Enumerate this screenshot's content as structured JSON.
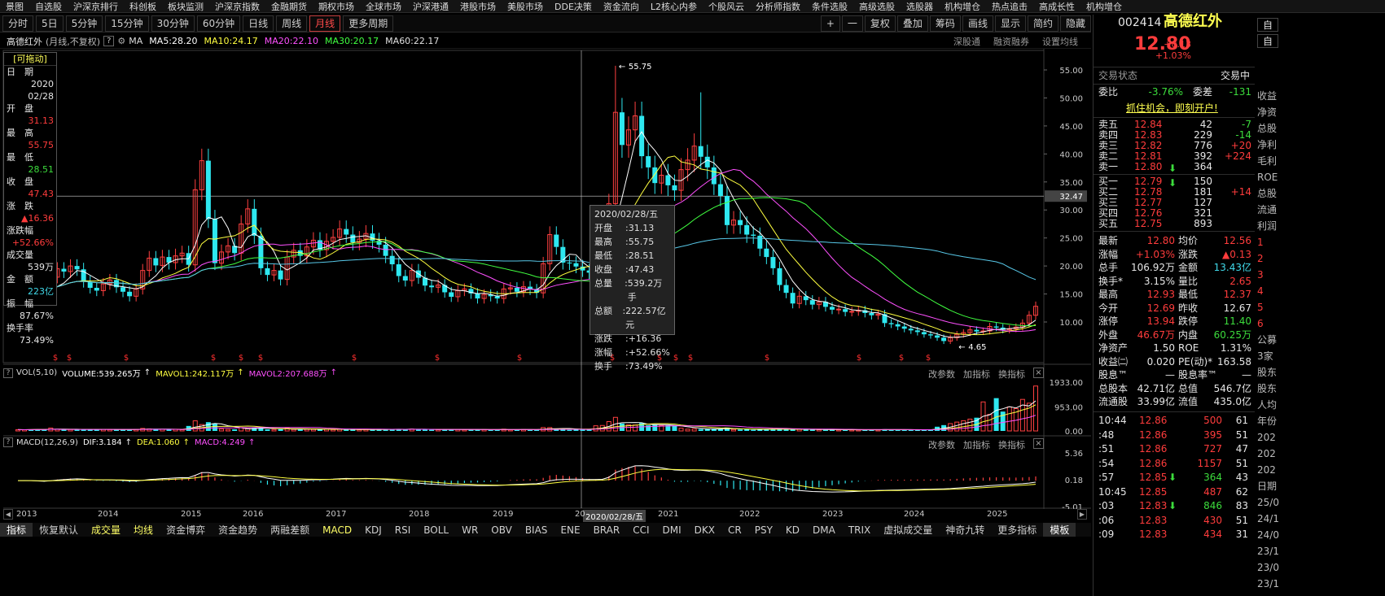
{
  "menu": [
    "景图",
    "自选股",
    "沪深京排行",
    "科创板",
    "板块监测",
    "沪深京指数",
    "金融期货",
    "期权市场",
    "全球市场",
    "沪深港通",
    "港股市场",
    "美股市场",
    "DDE决策",
    "资金流向",
    "L2核心内参",
    "个股风云",
    "分析师指数",
    "条件选股",
    "高级选股",
    "选股器",
    "机构增仓",
    "热点追击",
    "高成长性",
    "机构增仓"
  ],
  "timeframes": [
    {
      "label": "分时"
    },
    {
      "label": "5日"
    },
    {
      "label": "5分钟"
    },
    {
      "label": "15分钟"
    },
    {
      "label": "30分钟"
    },
    {
      "label": "60分钟"
    },
    {
      "label": "日线"
    },
    {
      "label": "周线"
    },
    {
      "label": "月线",
      "active": true
    },
    {
      "label": "更多周期"
    }
  ],
  "tools": [
    "+",
    "一",
    "复权",
    "叠加",
    "筹码",
    "画线",
    "显示",
    "简约",
    "隐藏"
  ],
  "header": {
    "name": "高德红外",
    "mode": "(月线,不复权)",
    "help": "?",
    "ma_label": "MA",
    "ma5": "MA5:28.20",
    "ma10": "MA10:24.17",
    "ma20": "MA20:22.10",
    "ma30": "MA30:20.17",
    "ma60": "MA60:22.17",
    "link1": "深股通",
    "link2": "融资融券",
    "link3": "设置均线"
  },
  "info_panel": {
    "title": "[可拖动]",
    "rows": [
      {
        "label": "日　期",
        "value": "2020"
      },
      {
        "label": "",
        "value": "02/28"
      },
      {
        "label": "开　盘",
        "value": "31.13",
        "color": "red"
      },
      {
        "label": "最　高",
        "value": "55.75",
        "color": "red"
      },
      {
        "label": "最　低",
        "value": "28.51",
        "color": "green"
      },
      {
        "label": "收　盘",
        "value": "47.43",
        "color": "red"
      },
      {
        "label": "涨　跌",
        "value": "▲16.36",
        "color": "red"
      },
      {
        "label": "涨跌幅",
        "value": "+52.66%",
        "color": "red"
      },
      {
        "label": "成交量",
        "value": "539万",
        "color": "white"
      },
      {
        "label": "金　额",
        "value": "223亿",
        "color": "cyan"
      },
      {
        "label": "振　幅",
        "value": "87.67%",
        "color": "white"
      },
      {
        "label": "换手率",
        "value": "73.49%",
        "color": "white"
      }
    ]
  },
  "tooltip": {
    "date": "2020/02/28/五",
    "rows": [
      {
        "k": "开盘",
        "v": "31.13"
      },
      {
        "k": "最高",
        "v": "55.75"
      },
      {
        "k": "最低",
        "v": "28.51"
      },
      {
        "k": "收盘",
        "v": "47.43"
      },
      {
        "k": "总量",
        "v": "539.2万手"
      },
      {
        "k": "总额",
        "v": "222.57亿元"
      },
      {
        "k": "涨跌",
        "v": "+16.36"
      },
      {
        "k": "涨幅",
        "v": "+52.66%"
      },
      {
        "k": "换手",
        "v": "73.49%"
      }
    ]
  },
  "price_axis": [
    "55.00",
    "50.00",
    "45.00",
    "40.00",
    "35.00",
    "30.00",
    "25.00",
    "20.00",
    "15.00",
    "10.00"
  ],
  "cursor_price": "32.47",
  "high_marker": "55.75",
  "low_marker": "4.65",
  "volume": {
    "label": "VOL(5,10)",
    "volume": "VOLUME:539.265万",
    "mavol1": "MAVOL1:242.117万",
    "mavol2": "MAVOL2:207.688万",
    "axis": [
      "1933.00",
      "953.00",
      "0.00"
    ]
  },
  "macd": {
    "label": "MACD(12,26,9)",
    "dif": "DIF:3.184",
    "dea": "DEA:1.060",
    "macd": "MACD:4.249",
    "axis": [
      "5.36",
      "0.18",
      "-5.01"
    ]
  },
  "panel_links": [
    "改参数",
    "加指标",
    "换指标"
  ],
  "close_btn": "×",
  "years": [
    "2013",
    "2014",
    "2015",
    "2016",
    "2017",
    "2018",
    "2019",
    "20",
    "2021",
    "2022",
    "2023",
    "2024",
    "2025"
  ],
  "cursor_date": "2020/02/28/五",
  "scroll_left": "◀",
  "scroll_right": "▶",
  "indicators": [
    {
      "label": "指标",
      "sel": true
    },
    {
      "label": "恢复默认"
    },
    {
      "label": "成交量",
      "hl": true
    },
    {
      "label": "均线",
      "hl": true
    },
    {
      "label": "资金博弈"
    },
    {
      "label": "资金趋势"
    },
    {
      "label": "两融差额"
    },
    {
      "label": "MACD",
      "hl": true
    },
    {
      "label": "KDJ"
    },
    {
      "label": "RSI"
    },
    {
      "label": "BOLL"
    },
    {
      "label": "WR"
    },
    {
      "label": "OBV"
    },
    {
      "label": "BIAS"
    },
    {
      "label": "ENE"
    },
    {
      "label": "BRAR"
    },
    {
      "label": "CCI"
    },
    {
      "label": "DMI"
    },
    {
      "label": "DKX"
    },
    {
      "label": "CR"
    },
    {
      "label": "PSY"
    },
    {
      "label": "KD"
    },
    {
      "label": "DMA"
    },
    {
      "label": "TRIX"
    },
    {
      "label": "虚拟成交量"
    },
    {
      "label": "神奇九转"
    },
    {
      "label": "更多指标"
    },
    {
      "label": "模板",
      "sel": true
    }
  ],
  "quote": {
    "code": "002414",
    "name": "高德红外",
    "price": "12.80",
    "change": "+0.13",
    "pct": "+1.03%",
    "status_label": "交易状态",
    "status": "交易中",
    "weibi_label": "委比",
    "weibi": "-3.76%",
    "weicha_label": "委差",
    "weicha": "-131",
    "promo": "抓住机会，即刻开户!",
    "sells": [
      {
        "l": "卖五",
        "p": "12.84",
        "v": "42",
        "d": "-7"
      },
      {
        "l": "卖四",
        "p": "12.83",
        "v": "229",
        "d": "-14"
      },
      {
        "l": "卖三",
        "p": "12.82",
        "v": "776",
        "d": "+20"
      },
      {
        "l": "卖二",
        "p": "12.81",
        "v": "392",
        "d": "+224"
      },
      {
        "l": "卖一",
        "p": "12.80",
        "v": "364",
        "d": ""
      }
    ],
    "buys": [
      {
        "l": "买一",
        "p": "12.79",
        "v": "150",
        "d": ""
      },
      {
        "l": "买二",
        "p": "12.78",
        "v": "181",
        "d": "+14"
      },
      {
        "l": "买三",
        "p": "12.77",
        "v": "127",
        "d": ""
      },
      {
        "l": "买四",
        "p": "12.76",
        "v": "321",
        "d": ""
      },
      {
        "l": "买五",
        "p": "12.75",
        "v": "893",
        "d": ""
      }
    ],
    "stats": [
      {
        "l1": "最新",
        "v1": "12.80",
        "l2": "均价",
        "v2": "12.56",
        "c1": "red",
        "c2": "red"
      },
      {
        "l1": "涨幅",
        "v1": "+1.03%",
        "l2": "涨跌",
        "v2": "▲0.13",
        "c1": "red",
        "c2": "red"
      },
      {
        "l1": "总手",
        "v1": "106.92万",
        "l2": "金额",
        "v2": "13.43亿",
        "c1": "white",
        "c2": "cyan"
      },
      {
        "l1": "换手*",
        "v1": "3.15%",
        "l2": "量比",
        "v2": "2.65",
        "c1": "white",
        "c2": "red"
      },
      {
        "l1": "最高",
        "v1": "12.93",
        "l2": "最低",
        "v2": "12.37",
        "c1": "red",
        "c2": "red"
      },
      {
        "l1": "今开",
        "v1": "12.69",
        "l2": "昨收",
        "v2": "12.67",
        "c1": "red",
        "c2": "white"
      },
      {
        "l1": "涨停",
        "v1": "13.94",
        "l2": "跌停",
        "v2": "11.40",
        "c1": "red",
        "c2": "green"
      },
      {
        "l1": "外盘",
        "v1": "46.67万",
        "l2": "内盘",
        "v2": "60.25万",
        "c1": "red",
        "c2": "green"
      },
      {
        "l1": "净资产",
        "v1": "1.50",
        "l2": "ROE",
        "v2": "1.31%",
        "c1": "white",
        "c2": "white"
      },
      {
        "l1": "收益㈡",
        "v1": "0.020",
        "l2": "PE(动)*",
        "v2": "163.58",
        "c1": "white",
        "c2": "white"
      },
      {
        "l1": "股息™",
        "v1": "—",
        "l2": "股息率™",
        "v2": "—",
        "c1": "white",
        "c2": "white"
      },
      {
        "l1": "总股本",
        "v1": "42.71亿",
        "l2": "总值",
        "v2": "546.7亿",
        "c1": "white",
        "c2": "white"
      },
      {
        "l1": "流通股",
        "v1": "33.99亿",
        "l2": "流值",
        "v2": "435.0亿",
        "c1": "white",
        "c2": "white"
      }
    ],
    "ticks": [
      {
        "t": "10:44",
        "p": "12.86",
        "v": "500",
        "n": "61",
        "c": "red",
        "vc": "red"
      },
      {
        "t": ":48",
        "p": "12.86",
        "v": "395",
        "n": "51",
        "c": "red",
        "vc": "red"
      },
      {
        "t": ":51",
        "p": "12.86",
        "v": "727",
        "n": "47",
        "c": "red",
        "vc": "red"
      },
      {
        "t": ":54",
        "p": "12.86",
        "v": "1157",
        "n": "51",
        "c": "red",
        "vc": "red"
      },
      {
        "t": ":57",
        "p": "12.85",
        "v": "364",
        "n": "43",
        "c": "red",
        "vc": "green",
        "arrow": "⬇"
      },
      {
        "t": "10:45",
        "p": "12.85",
        "v": "487",
        "n": "62",
        "c": "red",
        "vc": "red"
      },
      {
        "t": ":03",
        "p": "12.83",
        "v": "846",
        "n": "83",
        "c": "red",
        "vc": "green",
        "arrow": "⬇"
      },
      {
        "t": ":06",
        "p": "12.83",
        "v": "430",
        "n": "51",
        "c": "red",
        "vc": "red"
      },
      {
        "t": ":09",
        "p": "12.83",
        "v": "434",
        "n": "31",
        "c": "red",
        "vc": "red"
      }
    ]
  },
  "far_right": [
    "收益",
    "净资",
    "总股",
    "净利",
    "毛利",
    "ROE",
    "总股",
    "流通",
    "利润",
    "1",
    "2",
    "3",
    "4",
    "5",
    "6",
    "公募",
    "3家",
    "股东",
    "股东",
    "人均",
    "年份",
    "202",
    "202",
    "202",
    "日期",
    "25/0",
    "24/1",
    "24/0",
    "23/1",
    "23/0",
    "23/1"
  ],
  "far_right_top": [
    "自",
    "自"
  ]
}
